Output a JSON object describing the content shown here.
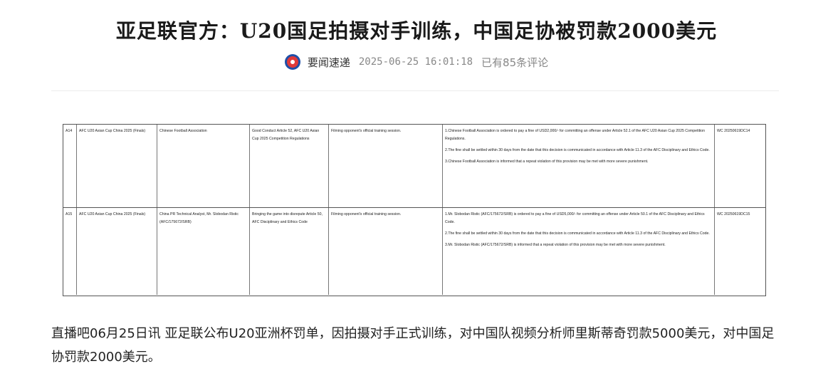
{
  "header": {
    "title": "亚足联官方：U20国足拍摄对手训练，中国足协被罚款2000美元",
    "source": "要闻速递",
    "datetime": "2025-06-25 16:01:18",
    "comments": "已有85条评论"
  },
  "document": {
    "rows": [
      {
        "no": "A14",
        "competition": "AFC U20 Asian Cup China 2025 (Finals)",
        "party": "Chinese Football Association",
        "regulation": "Good Conduct Article 52, AFC U20 Asian Cup 2025 Competition Regulations",
        "offence": "Filming opponent's official training session.",
        "decision_1": "1.Chinese Football Association is ordered to pay a fine of USD2,000/- for committing an offense under Article 52.1 of the AFC U20 Asian Cup 2025 Competition Regulations.",
        "decision_2": "2.The fine shall be settled within 30 days from the date that this decision is communicated in accordance with Article 11.3 of the AFC Disciplinary and Ethics Code.",
        "decision_3": "3.Chinese Football Association is informed that a repeat violation of this provision may be met with more severe punishment.",
        "ref": "WC 20250619DC14"
      },
      {
        "no": "A15",
        "competition": "AFC U20 Asian Cup China 2025 (Finals)",
        "party": "China PR Technical Analyst, Mr. Slobodan Ristic (AFC/175672/SRB)",
        "regulation": "Bringing the game into disrepute Article 50, AFC Disciplinary and Ethics Code",
        "offence": "Filming opponent's official training session.",
        "decision_1": "1.Mr. Slobodan Ristic (AFC/175672/SRB) is ordered to pay a fine of USD5,000/- for committing an offense under Article 50.1 of the AFC Disciplinary and Ethics Code.",
        "decision_2": "2.The fine shall be settled within 30 days from the date that this decision is communicated in accordance with Article 11.3 of the AFC Disciplinary and Ethics Code.",
        "decision_3": "3.Mr. Slobodan Ristic (AFC/175672/SRB) is informed that a repeat violation of this provision may be met with more severe punishment.",
        "ref": "WC 20250619DC15"
      }
    ]
  },
  "article": {
    "body": "直播吧06月25日讯 亚足联公布U20亚洲杯罚单，因拍摄对手正式训练，对中国队视频分析师里斯蒂奇罚款5000美元，对中国足协罚款2000美元。"
  }
}
